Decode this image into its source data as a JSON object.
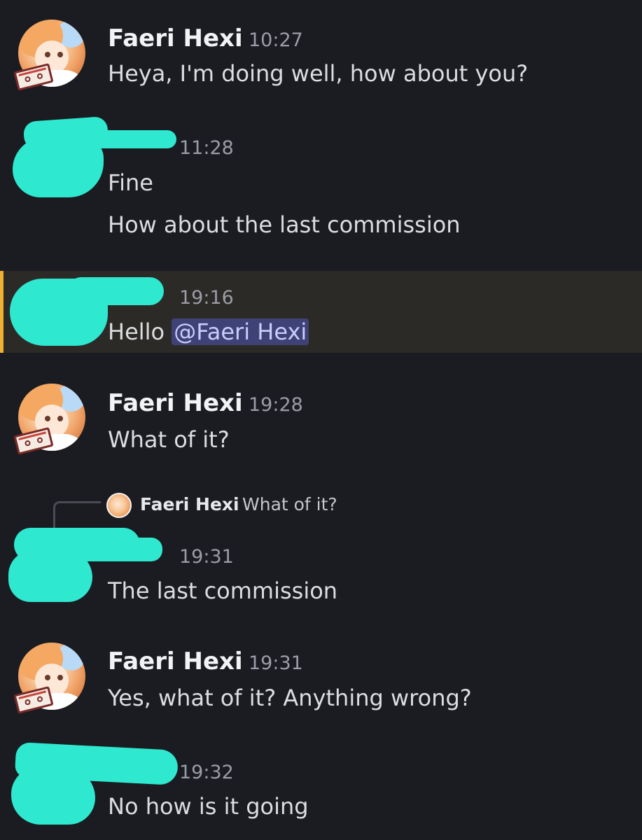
{
  "mention_prefix": "@",
  "messages": [
    {
      "author": "Faeri Hexi",
      "time": "10:27",
      "lines": [
        "Heya, I'm doing well, how about you?"
      ]
    },
    {
      "author": "",
      "time": "11:28",
      "lines": [
        "Fine",
        "How about the last commission"
      ]
    },
    {
      "author": "",
      "time": "19:16",
      "text_before_mention": "Hello ",
      "mention": "@Faeri Hexi"
    },
    {
      "author": "Faeri Hexi",
      "time": "19:28",
      "lines": [
        "What of it?"
      ]
    },
    {
      "author": "",
      "time": "19:31",
      "reply": {
        "author": "Faeri Hexi",
        "text": "What of it?"
      },
      "lines": [
        "The last commission"
      ]
    },
    {
      "author": "Faeri Hexi",
      "time": "19:31",
      "lines": [
        "Yes, what of it? Anything wrong?"
      ]
    },
    {
      "author": "",
      "time": "19:32",
      "lines": [
        "No how is it going"
      ]
    }
  ],
  "colors": {
    "background": "#1b1c22",
    "highlight_background": "#2c2a27",
    "highlight_bar": "#f0b132",
    "mention_background": "#3e4277",
    "redaction": "#2ee8cf"
  }
}
